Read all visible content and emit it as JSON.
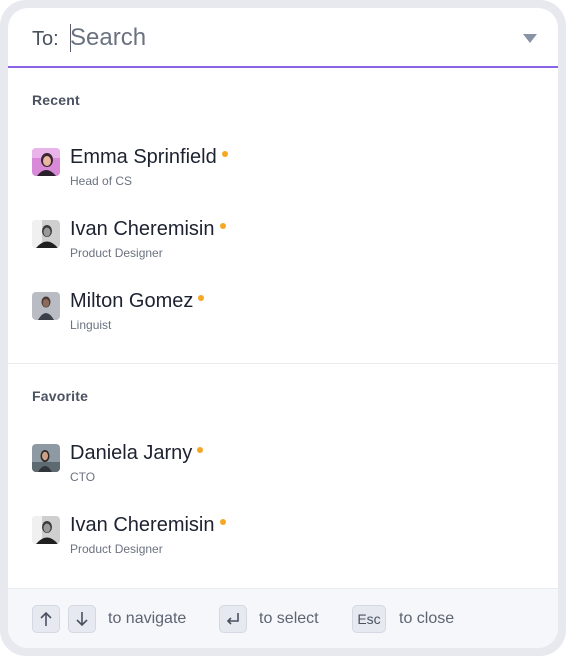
{
  "search": {
    "to_label": "To:",
    "placeholder": "Search",
    "value": ""
  },
  "recent": {
    "label": "Recent",
    "people": [
      {
        "name": "Emma Sprinfield",
        "role": "Head of CS"
      },
      {
        "name": "Ivan Cheremisin",
        "role": "Product Designer"
      },
      {
        "name": "Milton Gomez",
        "role": "Linguist"
      }
    ]
  },
  "favorite": {
    "label": "Favorite",
    "people": [
      {
        "name": "Daniela Jarny",
        "role": "CTO"
      },
      {
        "name": "Ivan Cheremisin",
        "role": "Product Designer"
      }
    ]
  },
  "footer": {
    "navigate_hint": "to navigate",
    "select_hint": "to select",
    "esc_key": "Esc",
    "close_hint": "to close"
  },
  "colors": {
    "accent": "#8a63e6",
    "status_dot": "#f5a623"
  },
  "icons": {
    "dropdown": "chevron-down-icon",
    "up": "arrow-up-icon",
    "down": "arrow-down-icon",
    "enter": "enter-key-icon"
  }
}
